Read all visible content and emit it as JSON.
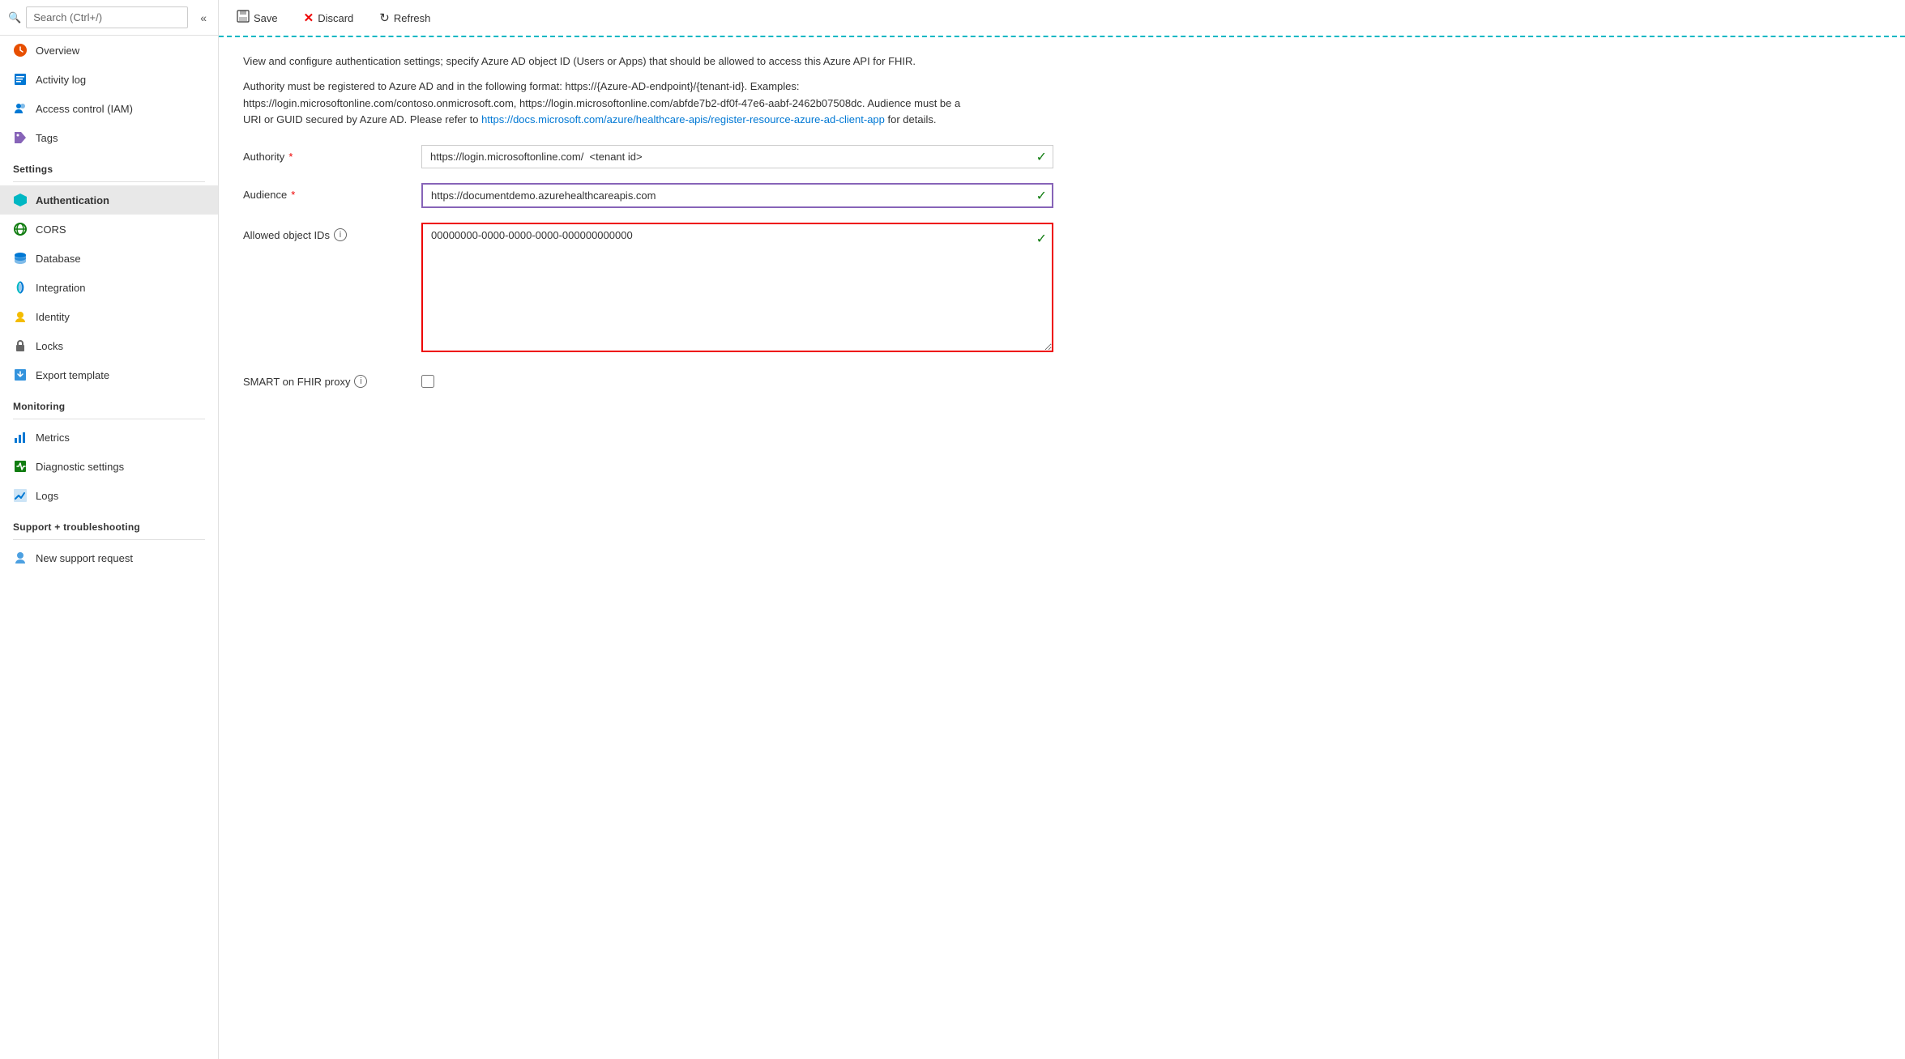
{
  "sidebar": {
    "search_placeholder": "Search (Ctrl+/)",
    "collapse_icon": "«",
    "nav_items": [
      {
        "id": "overview",
        "label": "Overview",
        "icon": "❤️",
        "icon_color": "orange",
        "active": false
      },
      {
        "id": "activity-log",
        "label": "Activity log",
        "icon": "📋",
        "icon_color": "blue",
        "active": false
      },
      {
        "id": "access-control",
        "label": "Access control (IAM)",
        "icon": "👥",
        "icon_color": "blue",
        "active": false
      },
      {
        "id": "tags",
        "label": "Tags",
        "icon": "🏷️",
        "icon_color": "purple",
        "active": false
      }
    ],
    "settings_label": "Settings",
    "settings_items": [
      {
        "id": "authentication",
        "label": "Authentication",
        "icon": "🔷",
        "icon_color": "cyan",
        "active": true
      },
      {
        "id": "cors",
        "label": "CORS",
        "icon": "🌐",
        "icon_color": "green",
        "active": false
      },
      {
        "id": "database",
        "label": "Database",
        "icon": "🗄️",
        "icon_color": "blue",
        "active": false
      },
      {
        "id": "integration",
        "label": "Integration",
        "icon": "☁️",
        "icon_color": "blue",
        "active": false
      },
      {
        "id": "identity",
        "label": "Identity",
        "icon": "⚙️",
        "icon_color": "yellow",
        "active": false
      },
      {
        "id": "locks",
        "label": "Locks",
        "icon": "🔒",
        "icon_color": "gray",
        "active": false
      },
      {
        "id": "export-template",
        "label": "Export template",
        "icon": "📦",
        "icon_color": "blue",
        "active": false
      }
    ],
    "monitoring_label": "Monitoring",
    "monitoring_items": [
      {
        "id": "metrics",
        "label": "Metrics",
        "icon": "📊",
        "icon_color": "blue",
        "active": false
      },
      {
        "id": "diagnostic-settings",
        "label": "Diagnostic settings",
        "icon": "📗",
        "icon_color": "green",
        "active": false
      },
      {
        "id": "logs",
        "label": "Logs",
        "icon": "📈",
        "icon_color": "blue",
        "active": false
      }
    ],
    "support_label": "Support + troubleshooting",
    "support_items": [
      {
        "id": "new-support-request",
        "label": "New support request",
        "icon": "👤",
        "icon_color": "blue",
        "active": false
      }
    ]
  },
  "toolbar": {
    "save_label": "Save",
    "discard_label": "Discard",
    "refresh_label": "Refresh"
  },
  "main": {
    "description1": "View and configure authentication settings; specify Azure AD object ID (Users or Apps) that should be allowed to access this Azure API for FHIR.",
    "description2_before": "Authority must be registered to Azure AD and in the following format: https://{Azure-AD-endpoint}/{tenant-id}. Examples: https://login.microsoftonline.com/contoso.onmicrosoft.com, https://login.microsoftonline.com/abfde7b2-df0f-47e6-aabf-2462b07508dc. Audience must be a URI or GUID secured by Azure AD. Please refer to ",
    "description2_link_text": "https://docs.microsoft.com/azure/healthcare-apis/register-resource-azure-ad-client-app",
    "description2_link_href": "https://docs.microsoft.com/azure/healthcare-apis/register-resource-azure-ad-client-app",
    "description2_after": " for details.",
    "form": {
      "authority_label": "Authority",
      "authority_required": true,
      "authority_value": "https://login.microsoftonline.com/  <tenant id>",
      "audience_label": "Audience",
      "audience_required": true,
      "audience_value": "https://documentdemo.azurehealthcareapis.com",
      "allowed_object_ids_label": "Allowed object IDs",
      "allowed_object_ids_value": "00000000-0000-0000-0000-000000000000",
      "smart_on_fhir_label": "SMART on FHIR proxy",
      "smart_on_fhir_checked": false
    }
  }
}
